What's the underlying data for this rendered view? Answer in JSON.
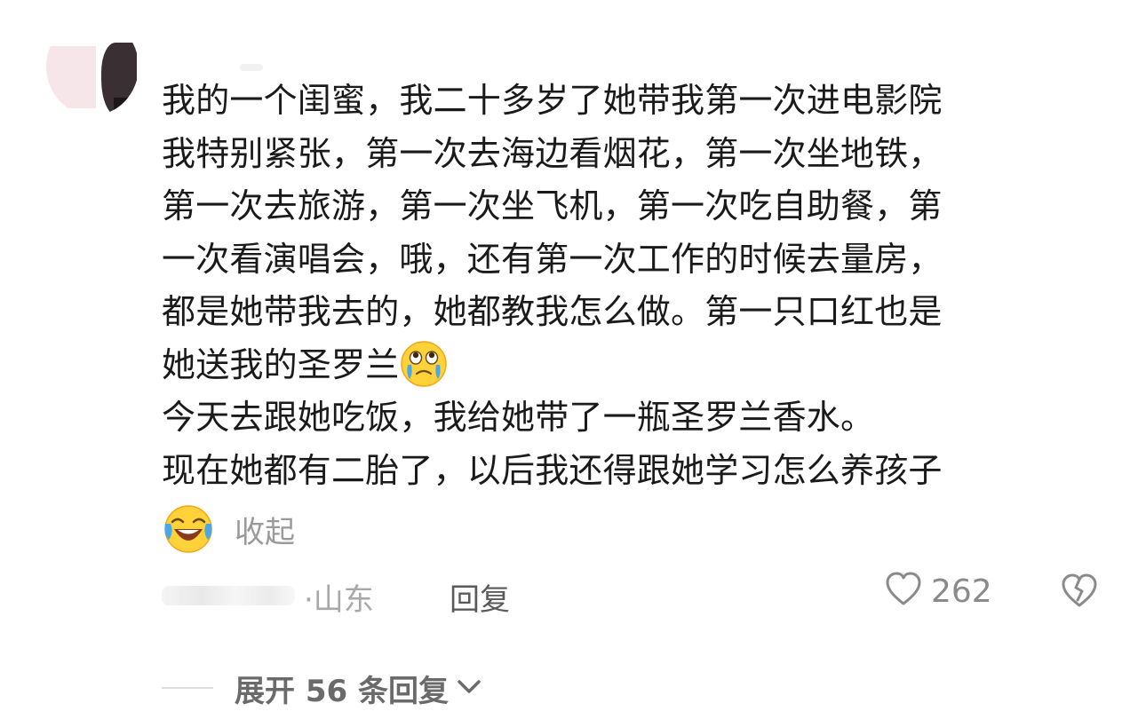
{
  "avatar": {
    "icon": "user-avatar"
  },
  "comment": {
    "lines": [
      "我的一个闺蜜，我二十多岁了她带我第一次进电影院",
      "我特别紧张，第一次去海边看烟花，第一次坐地铁，",
      "第一次去旅游，第一次坐飞机，第一次吃自助餐，第",
      "一次看演唱会，哦，还有第一次工作的时候去量房，",
      "都是她带我去的，她都教我怎么做。第一只口红也是",
      "她送我的圣罗兰",
      "今天去跟她吃饭，我给她带了一瓶圣罗兰香水。",
      "现在她都有二胎了，以后我还得跟她学习怎么养孩子"
    ],
    "inline_emoji": "teary-eyed-emoji",
    "trailing_emoji": "laughing-crying-emoji",
    "collapse_label": "收起"
  },
  "meta": {
    "location": "·山东",
    "reply_label": "回复",
    "like_count": "262",
    "like_icon": "heart-outline-icon",
    "dislike_icon": "broken-heart-icon"
  },
  "replies": {
    "expand_label": "展开 56 条回复",
    "chevron_icon": "chevron-down-icon"
  },
  "colors": {
    "text": "#1a1a1a",
    "muted": "#9a9a9a",
    "reply": "#5a5a5a",
    "emoji_yellow": "#ffd23a",
    "tear_blue": "#4aa8e8"
  }
}
